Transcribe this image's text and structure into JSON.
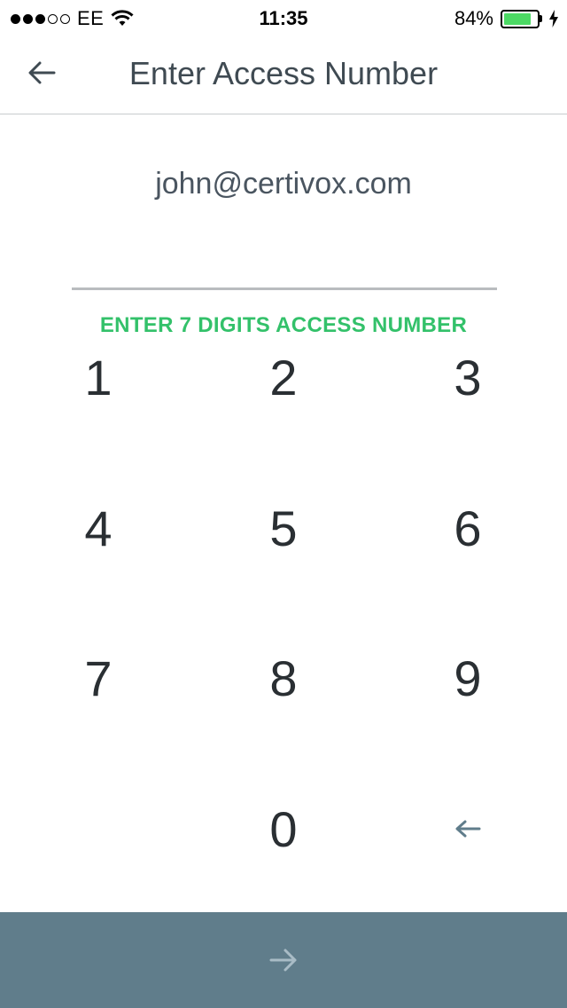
{
  "status_bar": {
    "signal_bars_filled": 3,
    "signal_bars_total": 5,
    "carrier": "EE",
    "time": "11:35",
    "battery_percent": "84%",
    "battery_level": 0.84,
    "battery_color": "#4cd964"
  },
  "nav": {
    "back_icon": "arrow-left-icon",
    "title": "Enter Access Number"
  },
  "account": {
    "email": "john@certivox.com"
  },
  "access_input": {
    "hint": "ENTER 7 DIGITS ACCESS NUMBER",
    "hint_color": "#33c16a"
  },
  "keypad": {
    "keys": [
      "1",
      "2",
      "3",
      "4",
      "5",
      "6",
      "7",
      "8",
      "9",
      "0"
    ],
    "backspace_icon": "backspace-arrow-icon"
  },
  "submit": {
    "icon": "arrow-right-icon",
    "background_color": "#607d8b"
  }
}
